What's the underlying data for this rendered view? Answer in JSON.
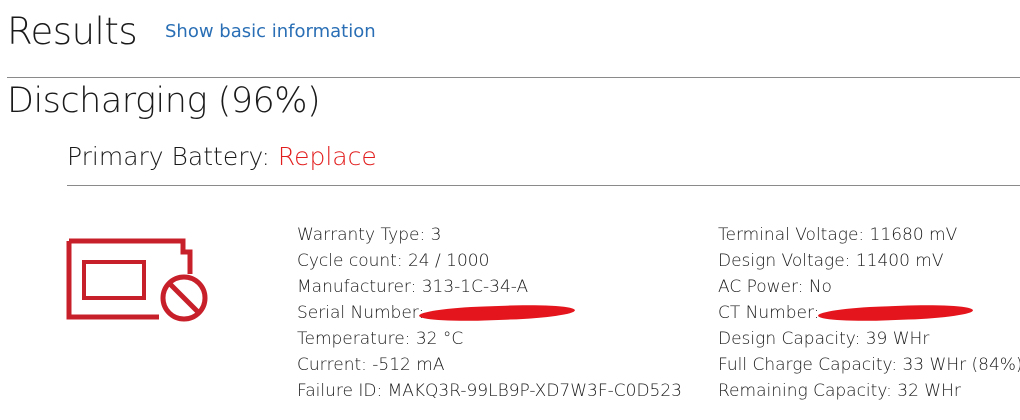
{
  "header": {
    "title": "Results",
    "basic_link": "Show basic information"
  },
  "status": {
    "heading": "Discharging (96%)"
  },
  "battery": {
    "label": "Primary Battery: ",
    "status": "Replace",
    "status_color": "#e21d1d",
    "icon": "battery-replace-icon"
  },
  "details_left": [
    "Warranty Type: 3",
    "Cycle count: 24 / 1000",
    "Manufacturer: 313-1C-34-A",
    "Serial Number:",
    "Temperature: 32 °C",
    "Current: -512 mA",
    "Failure ID: MAKQ3R-99LB9P-XD7W3F-C0D523"
  ],
  "details_right": [
    "Terminal Voltage: 11680 mV",
    "Design Voltage: 11400 mV",
    "AC Power: No",
    "CT Number:",
    "Design Capacity: 39 WHr",
    "Full Charge Capacity: 33 WHr (84%)",
    "Remaining Capacity: 32 WHr"
  ],
  "colors": {
    "link": "#2a6fb5",
    "alert": "#e21d1d",
    "icon": "#c8202a",
    "redaction": "#e4151c"
  }
}
